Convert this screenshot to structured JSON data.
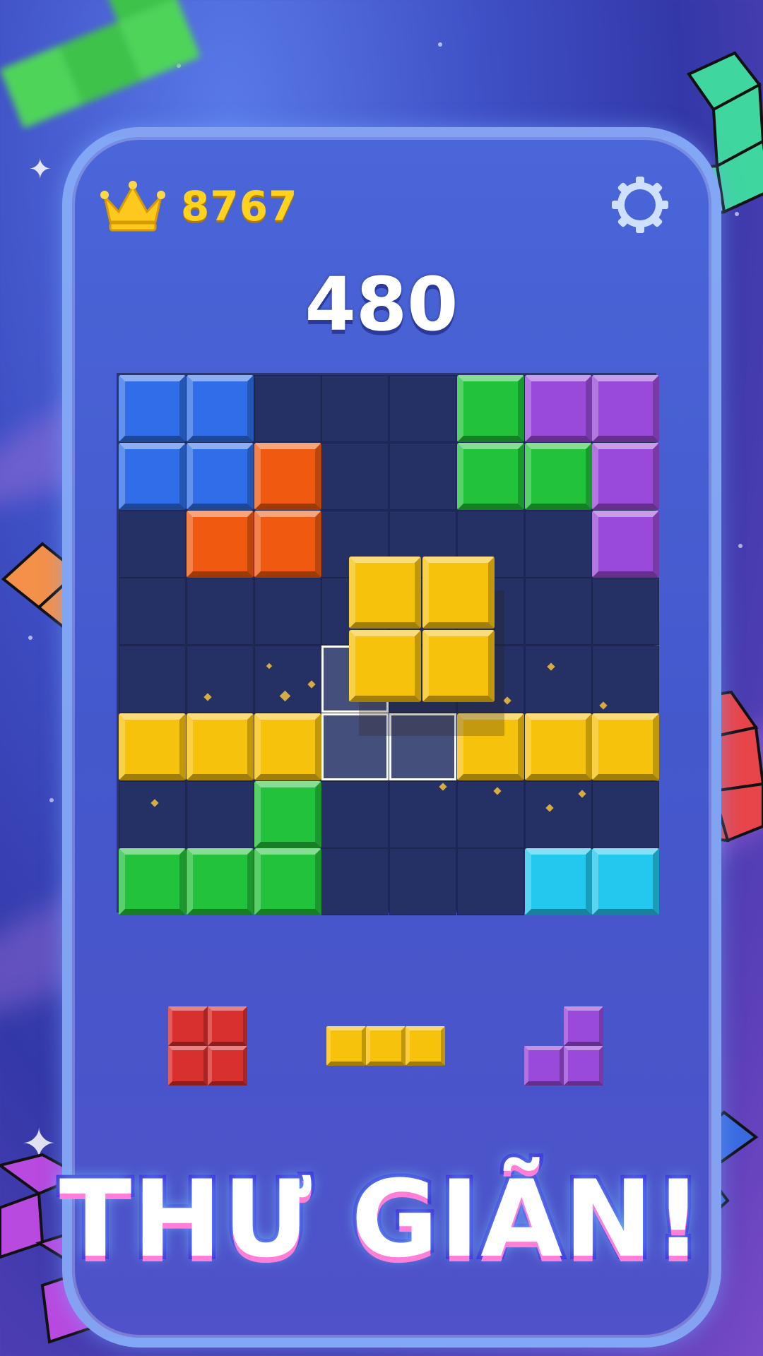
{
  "hud": {
    "best_score": "8767",
    "score": "480",
    "crown_icon": "crown-icon",
    "settings_icon": "gear-icon"
  },
  "board": {
    "rows": 8,
    "cols": 8,
    "grid": [
      [
        "blue",
        "blue",
        null,
        null,
        null,
        "green",
        "purple",
        "purple"
      ],
      [
        "blue",
        "blue",
        "orange",
        null,
        null,
        "green",
        "green",
        "purple"
      ],
      [
        null,
        "orange",
        "orange",
        null,
        null,
        null,
        null,
        "purple"
      ],
      [
        null,
        null,
        null,
        null,
        null,
        null,
        null,
        null
      ],
      [
        null,
        null,
        null,
        "ghost",
        null,
        null,
        null,
        null
      ],
      [
        "yellow",
        "yellow",
        "yellow",
        "ghost",
        "ghost",
        "yellow",
        "yellow",
        "yellow"
      ],
      [
        null,
        null,
        "green",
        null,
        null,
        null,
        null,
        null
      ],
      [
        "green",
        "green",
        "green",
        null,
        null,
        null,
        "cyan",
        "cyan"
      ]
    ],
    "dragging_piece": {
      "shape": "square-2x2",
      "color": "yellow"
    }
  },
  "tray": [
    {
      "shape": "square-2x2",
      "color": "red",
      "cells": [
        [
          0,
          0
        ],
        [
          1,
          0
        ],
        [
          0,
          1
        ],
        [
          1,
          1
        ]
      ]
    },
    {
      "shape": "line-3",
      "color": "yellow",
      "cells": [
        [
          0,
          0
        ],
        [
          1,
          0
        ],
        [
          2,
          0
        ]
      ]
    },
    {
      "shape": "corner-3",
      "color": "purple",
      "cells": [
        [
          1,
          0
        ],
        [
          0,
          1
        ],
        [
          1,
          1
        ]
      ]
    }
  ],
  "banner": {
    "text": "THƯ GIÃN!"
  },
  "colors": {
    "blue": "#2f6ee8",
    "green": "#22c23a",
    "purple": "#9a4ad8",
    "orange": "#f05a10",
    "yellow": "#f7c20c",
    "cyan": "#22c8ee",
    "red": "#d8302e",
    "gold": "#ffd21e"
  }
}
